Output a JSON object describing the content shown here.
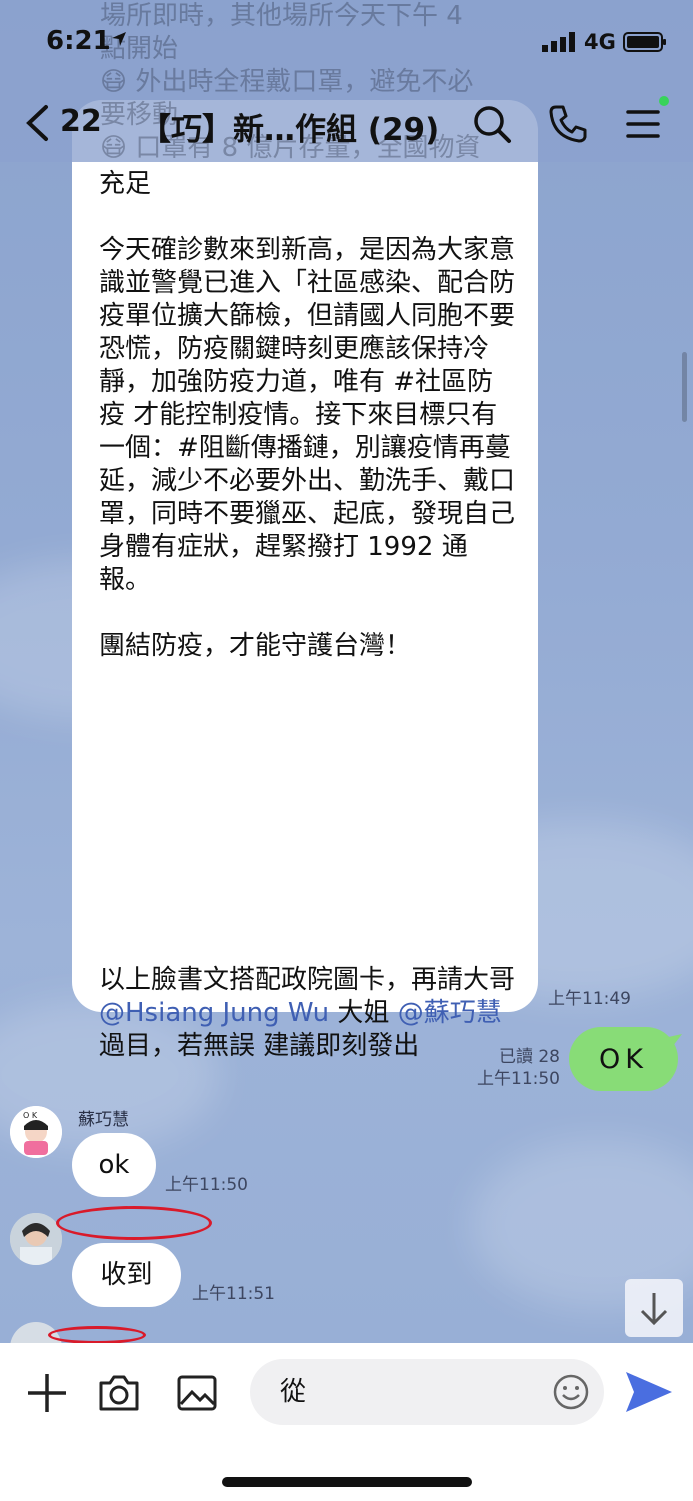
{
  "status_bar": {
    "time": "6:21",
    "network": "4G"
  },
  "header": {
    "back_count": "22",
    "title": "【巧】新…作組 (29)"
  },
  "ghost_text": "場所即時，其他場所今天下午 4\n點開始\n😷 外出時全程戴口罩，避免不必\n要移動\n😷 口罩有 8 億片存量，全國物資",
  "message_big": {
    "body": "充足\n\n今天確診數來到新高，是因為大家意識並警覺已進入「社區感染、配合防疫單位擴大篩檢，但請國人同胞不要恐慌，防疫關鍵時刻更應該保持冷靜，加強防疫力道，唯有 #社區防疫 才能控制疫情。接下來目標只有一個：#阻斷傳播鏈，別讓疫情再蔓延，減少不必要外出、勤洗手、戴口罩，同時不要獵巫、起底，發現自己身體有症狀，趕緊撥打 1992 通報。\n\n團結防疫，才能守護台灣！",
    "tail_pre": "以上臉書文搭配政院圖卡，再請大哥 ",
    "mention1": "@Hsiang Jung Wu",
    "tail_mid": " 大姐 ",
    "mention2": "@蘇巧慧",
    "tail_post": " 過目，若無誤 建議即刻發出",
    "time": "上午11:49"
  },
  "my_message": {
    "text": "OK",
    "read": "已讀 28",
    "time": "上午11:50"
  },
  "messages": [
    {
      "sender": "蘇巧慧",
      "text": "ok",
      "time": "上午11:50"
    },
    {
      "sender": "",
      "text": "收到",
      "time": "上午11:51"
    }
  ],
  "input": {
    "value": "從"
  },
  "colors": {
    "accent": "#3f5fb3",
    "my_bubble": "#88dc77",
    "send": "#4a6ee0"
  }
}
